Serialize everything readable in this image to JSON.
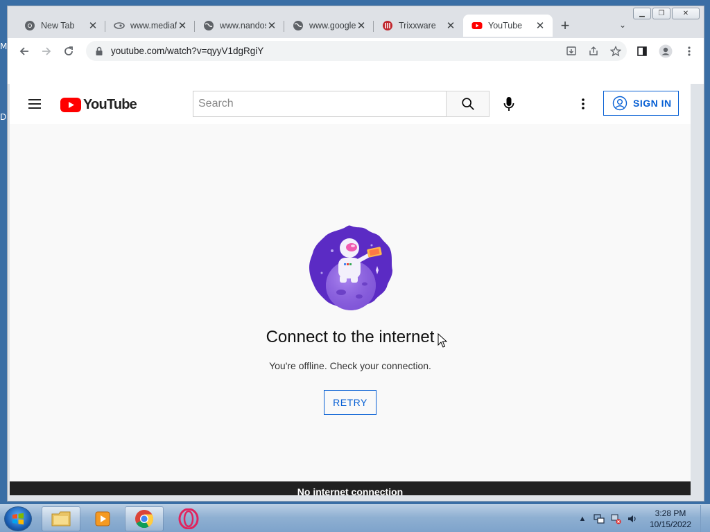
{
  "desktop": {
    "edge_letters": [
      "M",
      "D"
    ]
  },
  "window": {
    "controls": [
      "minimize",
      "restore",
      "close"
    ]
  },
  "tabs": [
    {
      "title": "New Tab",
      "icon": "chrome-icon"
    },
    {
      "title": "www.mediafire",
      "icon": "page-icon"
    },
    {
      "title": "www.nandos",
      "icon": "globe-icon"
    },
    {
      "title": "www.google",
      "icon": "globe-icon"
    },
    {
      "title": "Trixxware",
      "icon": "trixxware-icon"
    },
    {
      "title": "YouTube",
      "icon": "youtube-icon",
      "active": true
    }
  ],
  "omnibox": {
    "url": "youtube.com/watch?v=qyyV1dgRgiY"
  },
  "youtube": {
    "wordmark": "YouTube",
    "search_placeholder": "Search",
    "sign_in": "SIGN IN"
  },
  "offline": {
    "title": "Connect to the internet",
    "subtitle": "You're offline. Check your connection.",
    "retry": "RETRY",
    "banner": "No internet connection"
  },
  "taskbar": {
    "time": "3:28 PM",
    "date": "10/15/2022"
  },
  "colors": {
    "youtube_red": "#ff0000",
    "link_blue": "#065fd4",
    "offline_bar": "#212121"
  }
}
